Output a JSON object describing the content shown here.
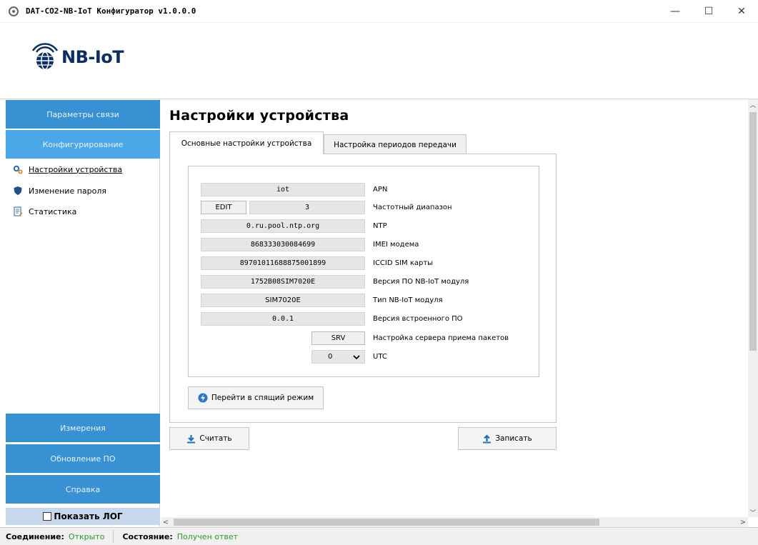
{
  "window": {
    "title": "DAT-CO2-NB-IoT Конфигуратор v1.0.0.0",
    "minimize": "—",
    "maximize": "☐",
    "close": "✕"
  },
  "logo": {
    "text": "NB-IoT"
  },
  "sidebar": {
    "params": "Параметры связи",
    "config": "Конфигурирование",
    "items": [
      {
        "label": "Настройки устройства",
        "icon": "gears-icon"
      },
      {
        "label": "Изменение пароля",
        "icon": "shield-icon"
      },
      {
        "label": "Статистика",
        "icon": "document-icon"
      }
    ],
    "measurements": "Измерения",
    "update": "Обновление ПО",
    "help": "Справка",
    "show_log": "Показать ЛОГ"
  },
  "main": {
    "title": "Настройки устройства",
    "tabs": [
      {
        "label": "Основные настройки устройства"
      },
      {
        "label": "Настройка периодов передачи"
      }
    ],
    "fields": [
      {
        "value": "iot",
        "label": "APN"
      },
      {
        "value": "3",
        "label": "Частотный диапазон",
        "button": "EDIT"
      },
      {
        "value": "0.ru.pool.ntp.org",
        "label": "NTP"
      },
      {
        "value": "868333030084699",
        "label": "IMEI модема"
      },
      {
        "value": "89701011688875001899",
        "label": "ICCID SIM карты"
      },
      {
        "value": "1752B08SIM7020E",
        "label": "Версия ПО NB-IoT модуля"
      },
      {
        "value": "SIM7020E",
        "label": "Тип NB-IoT модуля"
      },
      {
        "value": "0.0.1",
        "label": "Версия встроенного ПО"
      },
      {
        "value": "SRV",
        "label": "Настройка сервера приема пакетов"
      },
      {
        "value": "0",
        "label": "UTC"
      }
    ],
    "sleep_button": "Перейти в спящий режим",
    "read_button": "Считать",
    "write_button": "Записать"
  },
  "status": {
    "connection_key": "Соединение:",
    "connection_val": "Открыто",
    "state_key": "Состояние:",
    "state_val": "Получен ответ"
  },
  "colors": {
    "nav": "#3891d3",
    "nav_active": "#4aa8e8",
    "status_ok": "#2a9a2a",
    "logo": "#0d2e63"
  }
}
